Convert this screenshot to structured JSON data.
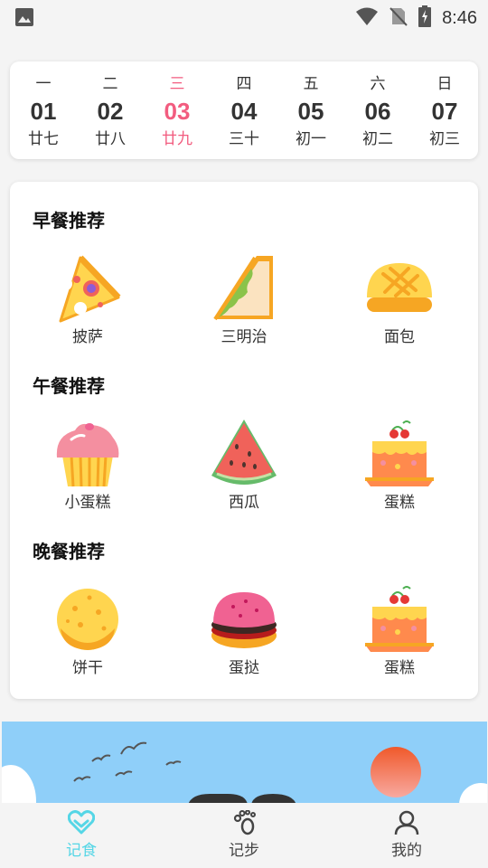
{
  "status_bar": {
    "time": "8:46"
  },
  "week": [
    {
      "weekday": "一",
      "date": "01",
      "lunar": "廿七",
      "today": false
    },
    {
      "weekday": "二",
      "date": "02",
      "lunar": "廿八",
      "today": false
    },
    {
      "weekday": "三",
      "date": "03",
      "lunar": "廿九",
      "today": true
    },
    {
      "weekday": "四",
      "date": "04",
      "lunar": "三十",
      "today": false
    },
    {
      "weekday": "五",
      "date": "05",
      "lunar": "初一",
      "today": false
    },
    {
      "weekday": "六",
      "date": "06",
      "lunar": "初二",
      "today": false
    },
    {
      "weekday": "日",
      "date": "07",
      "lunar": "初三",
      "today": false
    }
  ],
  "breakfast": {
    "title": "早餐推荐",
    "items": [
      {
        "name": "披萨",
        "icon": "pizza-icon"
      },
      {
        "name": "三明治",
        "icon": "sandwich-icon"
      },
      {
        "name": "面包",
        "icon": "bread-icon"
      }
    ]
  },
  "lunch": {
    "title": "午餐推荐",
    "items": [
      {
        "name": "小蛋糕",
        "icon": "cupcake-icon"
      },
      {
        "name": "西瓜",
        "icon": "watermelon-icon"
      },
      {
        "name": "蛋糕",
        "icon": "cake-icon"
      }
    ]
  },
  "dinner": {
    "title": "晚餐推荐",
    "items": [
      {
        "name": "饼干",
        "icon": "cookie-icon"
      },
      {
        "name": "蛋挞",
        "icon": "macaron-icon"
      },
      {
        "name": "蛋糕",
        "icon": "cake-icon"
      }
    ]
  },
  "tabs": [
    {
      "label": "记食",
      "icon": "heart-icon",
      "active": true
    },
    {
      "label": "记步",
      "icon": "footprint-icon",
      "active": false
    },
    {
      "label": "我的",
      "icon": "profile-icon",
      "active": false
    }
  ],
  "colors": {
    "today": "#f25c7f",
    "tab_active": "#55d6e6",
    "banner_sky": "#8fcff9"
  }
}
